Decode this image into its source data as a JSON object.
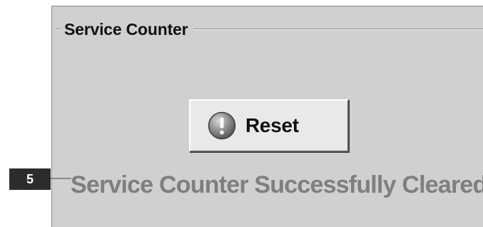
{
  "groupbox": {
    "title": "Service Counter"
  },
  "reset_button": {
    "label": "Reset",
    "icon": "alert-icon"
  },
  "callout": {
    "number": "5"
  },
  "status": {
    "message": "Service Counter Successfully Cleared"
  },
  "colors": {
    "panel_background": "#d0d0d0",
    "status_text": "#7f7f7f",
    "callout_badge": "#2c2c2c"
  }
}
